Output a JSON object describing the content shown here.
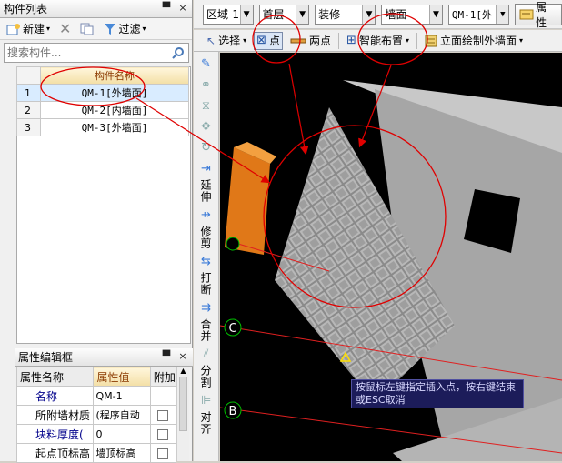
{
  "component_list": {
    "title": "构件列表",
    "pin": "ꟼ",
    "close": "×",
    "new_label": "新建",
    "filter_label": "过滤",
    "search_placeholder": "搜索构件...",
    "column_header": "构件名称",
    "rows": [
      {
        "num": "1",
        "name": "QM-1[外墙面]",
        "selected": true
      },
      {
        "num": "2",
        "name": "QM-2[内墙面]",
        "selected": false
      },
      {
        "num": "3",
        "name": "QM-3[外墙面]",
        "selected": false
      }
    ]
  },
  "property_editor": {
    "title": "属性编辑框",
    "headers": [
      "属性名称",
      "属性值",
      "附加"
    ],
    "rows": [
      {
        "name": "名称",
        "value": "QM-1",
        "blue": true,
        "checkbox": false
      },
      {
        "name": "所附墙材质",
        "value": "(程序自动",
        "blue": false,
        "checkbox": true
      },
      {
        "name": "块料厚度(",
        "value": "0",
        "blue": true,
        "checkbox": true
      },
      {
        "name": "起点顶标高",
        "value": "墙顶标高",
        "blue": false,
        "checkbox": true
      }
    ]
  },
  "toolbar_top": {
    "region": "区域-1",
    "floor": "首层",
    "category": "装修",
    "type": "墙面",
    "component": "QM-1[外",
    "attr_btn": "属性"
  },
  "toolbar_draw": {
    "select": "选择",
    "point": "点",
    "two_points": "两点",
    "smart_layout": "智能布置",
    "elevation_draw": "立面绘制外墙面"
  },
  "vertical_toolbar": {
    "extend": "延伸",
    "trim": "修剪",
    "break": "打断",
    "merge": "合并",
    "split": "分割",
    "align": "对齐"
  },
  "canvas": {
    "axis_c": "C",
    "axis_b": "B",
    "tooltip": "按鼠标左键指定插入点，按右键结束或ESC取消"
  },
  "colors": {
    "annotation_red": "#e00000",
    "header_orange": "#f3dfa6",
    "axis_green": "#00c000"
  }
}
